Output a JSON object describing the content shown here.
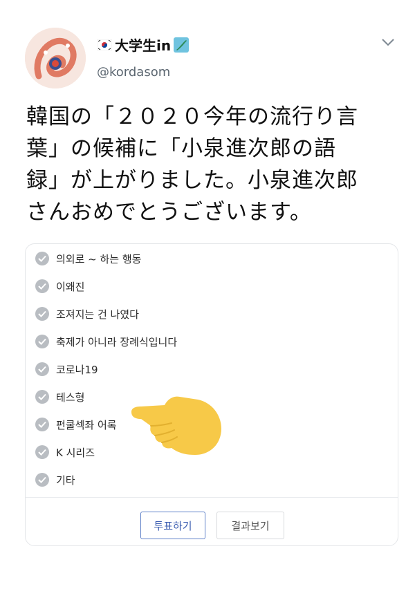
{
  "tweet": {
    "display_name": "大学生in",
    "handle": "@kordasom",
    "text_lines": [
      "韓国の「２０２０今年の流行り言",
      "葉」の候補に「小泉進次郎の語",
      "録」が上がりました。小泉進次郎",
      "さんおめでとうございます。"
    ]
  },
  "poll": {
    "options": [
      "의외로 ~ 하는 행동",
      "이왜진",
      "조져지는 건 나였다",
      "축제가 아니라 장례식입니다",
      "코로나19",
      "테스형",
      "펀쿨섹좌 어록",
      "K 시리즈",
      "기타"
    ],
    "vote_label": "투표하기",
    "results_label": "결과보기"
  },
  "icons": {
    "flag_left": "korea-flag-icon",
    "flag_right": "japan-map-flag-icon",
    "menu": "chevron-down-icon",
    "option_check": "check-circle-icon",
    "pointer": "pointing-hand-icon"
  },
  "colors": {
    "accent": "#3a5cb0",
    "check_gray": "#b9bdc2",
    "hand_yellow": "#f7c948"
  }
}
